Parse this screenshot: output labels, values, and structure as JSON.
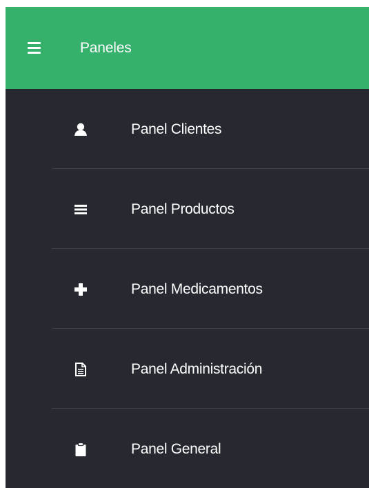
{
  "header": {
    "icon": "hamburger-icon",
    "title": "Paneles",
    "background": "#35b16b"
  },
  "menu": {
    "background": "#262930",
    "items": [
      {
        "label": "Panel Clientes",
        "icon": "user-icon"
      },
      {
        "label": "Panel Productos",
        "icon": "list-icon"
      },
      {
        "label": "Panel Medicamentos",
        "icon": "plus-icon"
      },
      {
        "label": "Panel Administración",
        "icon": "document-icon"
      },
      {
        "label": "Panel General",
        "icon": "clipboard-icon"
      }
    ]
  }
}
